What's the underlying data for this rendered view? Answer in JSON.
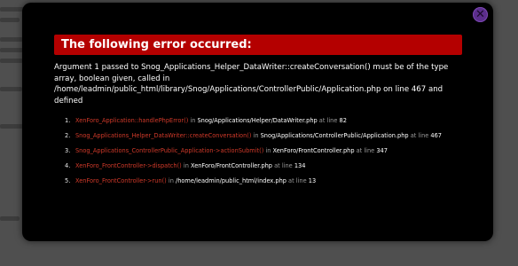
{
  "dialog": {
    "title": "The following error occurred:",
    "message": "Argument 1 passed to Snog_Applications_Helper_DataWriter::createConversation() must be of the type array, boolean given, called in /home/leadmin/public_html/library/Snog/Applications/ControllerPublic/Application.php on line 467 and defined",
    "close_icon": "close-icon"
  },
  "trace": [
    {
      "num": "1.",
      "func": "XenForo_Application::handlePhpError()",
      "in": " in ",
      "path": "Snog/Applications/Helper/DataWriter.php",
      "at": " at line ",
      "line": "82"
    },
    {
      "num": "2.",
      "func": "Snog_Applications_Helper_DataWriter::createConversation()",
      "in": " in ",
      "path": "Snog/Applications/ControllerPublic/Application.php",
      "at": " at line ",
      "line": "467"
    },
    {
      "num": "3.",
      "func": "Snog_Applications_ControllerPublic_Application->actionSubmit()",
      "in": " in ",
      "path": "XenForo/FrontController.php",
      "at": " at line ",
      "line": "347"
    },
    {
      "num": "4.",
      "func": "XenForo_FrontController->dispatch()",
      "in": " in ",
      "path": "XenForo/FrontController.php",
      "at": " at line ",
      "line": "134"
    },
    {
      "num": "5.",
      "func": "XenForo_FrontController->run()",
      "in": " in ",
      "path": "/home/leadmin/public_html/index.php",
      "at": " at line ",
      "line": "13"
    }
  ],
  "colors": {
    "header_bg": "#b40000",
    "overlay_bg": "#000000",
    "close_bg": "#5b2d8c",
    "func": "#d23a2a"
  }
}
